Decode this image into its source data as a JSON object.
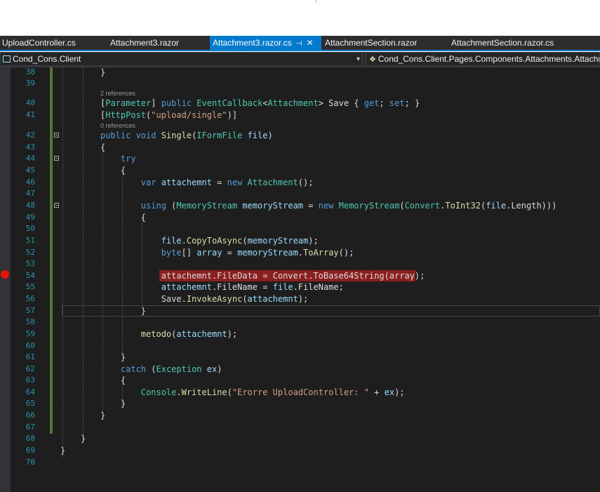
{
  "tabs": [
    {
      "label": "UploadController.cs",
      "active": false
    },
    {
      "label": "Attachment3.razor",
      "active": false
    },
    {
      "label": "Attachment3.razor.cs",
      "active": true
    },
    {
      "label": "AttachmentSection.razor",
      "active": false
    },
    {
      "label": "AttachmentSection.razor.cs",
      "active": false
    }
  ],
  "tab_icons": {
    "pin": "pin-icon",
    "close": "close-icon"
  },
  "navbar": {
    "project": "Cond_Cons.Client",
    "class_path": "Cond_Cons.Client.Pages.Components.Attachments.Attachm"
  },
  "codelens": {
    "line40": "2 references",
    "line42": "0 references"
  },
  "lines": [
    {
      "num": "38",
      "tokens": [
        [
          "pr",
          "}"
        ]
      ]
    },
    {
      "num": "39",
      "tokens": []
    },
    {
      "num": "40",
      "tokens": [
        [
          "pr",
          "["
        ],
        [
          "ty",
          "Parameter"
        ],
        [
          "pr",
          "] "
        ],
        [
          "kw",
          "public "
        ],
        [
          "ty",
          "EventCallback"
        ],
        [
          "pr",
          "<"
        ],
        [
          "ty",
          "Attachment"
        ],
        [
          "pr",
          "> Save { "
        ],
        [
          "kw",
          "get"
        ],
        [
          "pr",
          "; "
        ],
        [
          "kw",
          "set"
        ],
        [
          "pr",
          "; }"
        ]
      ]
    },
    {
      "num": "41",
      "tokens": [
        [
          "pr",
          "["
        ],
        [
          "ty",
          "HttpPost"
        ],
        [
          "pr",
          "("
        ],
        [
          "st",
          "\"upload/single\""
        ],
        [
          "pr",
          ")]"
        ]
      ]
    },
    {
      "num": "42",
      "tokens": [
        [
          "kw",
          "public void "
        ],
        [
          "fn",
          "Single"
        ],
        [
          "pr",
          "("
        ],
        [
          "ty",
          "IFormFile"
        ],
        [
          "pr",
          " "
        ],
        [
          "vr",
          "file"
        ],
        [
          "pr",
          ")"
        ]
      ]
    },
    {
      "num": "43",
      "tokens": [
        [
          "pr",
          "{"
        ]
      ]
    },
    {
      "num": "44",
      "tokens": [
        [
          "pr",
          "    "
        ],
        [
          "kw",
          "try"
        ]
      ]
    },
    {
      "num": "45",
      "tokens": [
        [
          "pr",
          "    {"
        ]
      ]
    },
    {
      "num": "46",
      "tokens": [
        [
          "pr",
          "        "
        ],
        [
          "kw",
          "var "
        ],
        [
          "vr",
          "attachemnt"
        ],
        [
          "pr",
          " = "
        ],
        [
          "kw",
          "new "
        ],
        [
          "ty",
          "Attachment"
        ],
        [
          "pr",
          "();"
        ]
      ]
    },
    {
      "num": "47",
      "tokens": []
    },
    {
      "num": "48",
      "tokens": [
        [
          "pr",
          "        "
        ],
        [
          "kw",
          "using "
        ],
        [
          "pr",
          "("
        ],
        [
          "ty",
          "MemoryStream"
        ],
        [
          "pr",
          " "
        ],
        [
          "vr",
          "memoryStream"
        ],
        [
          "pr",
          " = "
        ],
        [
          "kw",
          "new "
        ],
        [
          "ty",
          "MemoryStream"
        ],
        [
          "pr",
          "("
        ],
        [
          "ty",
          "Convert"
        ],
        [
          "pr",
          "."
        ],
        [
          "fn",
          "ToInt32"
        ],
        [
          "pr",
          "("
        ],
        [
          "vr",
          "file"
        ],
        [
          "pr",
          ".Length)))"
        ]
      ]
    },
    {
      "num": "49",
      "tokens": [
        [
          "pr",
          "        {"
        ]
      ]
    },
    {
      "num": "50",
      "tokens": []
    },
    {
      "num": "51",
      "tokens": [
        [
          "pr",
          "            "
        ],
        [
          "vr",
          "file"
        ],
        [
          "pr",
          "."
        ],
        [
          "fn",
          "CopyToAsync"
        ],
        [
          "pr",
          "("
        ],
        [
          "vr",
          "memoryStream"
        ],
        [
          "pr",
          ");"
        ]
      ]
    },
    {
      "num": "52",
      "tokens": [
        [
          "pr",
          "            "
        ],
        [
          "kw",
          "byte"
        ],
        [
          "pr",
          "[] "
        ],
        [
          "vr",
          "array"
        ],
        [
          "pr",
          " = "
        ],
        [
          "vr",
          "memoryStream"
        ],
        [
          "pr",
          "."
        ],
        [
          "fn",
          "ToArray"
        ],
        [
          "pr",
          "();"
        ]
      ]
    },
    {
      "num": "53",
      "tokens": []
    },
    {
      "num": "54",
      "tokens": [
        [
          "pr",
          "            attachemnt.FileData = Convert.ToBase64String(array);"
        ]
      ]
    },
    {
      "num": "55",
      "tokens": [
        [
          "pr",
          "            "
        ],
        [
          "vr",
          "attachemnt"
        ],
        [
          "pr",
          ".FileName = "
        ],
        [
          "vr",
          "file"
        ],
        [
          "pr",
          ".FileName;"
        ]
      ]
    },
    {
      "num": "56",
      "tokens": [
        [
          "pr",
          "            Save."
        ],
        [
          "fn",
          "InvokeAsync"
        ],
        [
          "pr",
          "("
        ],
        [
          "vr",
          "attachemnt"
        ],
        [
          "pr",
          ");"
        ]
      ]
    },
    {
      "num": "57",
      "tokens": [
        [
          "pr",
          "        }"
        ]
      ]
    },
    {
      "num": "58",
      "tokens": []
    },
    {
      "num": "59",
      "tokens": [
        [
          "pr",
          "        "
        ],
        [
          "fn",
          "metodo"
        ],
        [
          "pr",
          "("
        ],
        [
          "vr",
          "attachemnt"
        ],
        [
          "pr",
          ");"
        ]
      ]
    },
    {
      "num": "60",
      "tokens": []
    },
    {
      "num": "61",
      "tokens": [
        [
          "pr",
          "    }"
        ]
      ]
    },
    {
      "num": "62",
      "tokens": [
        [
          "pr",
          "    "
        ],
        [
          "kw",
          "catch "
        ],
        [
          "pr",
          "("
        ],
        [
          "ty",
          "Exception"
        ],
        [
          "pr",
          " "
        ],
        [
          "vr",
          "ex"
        ],
        [
          "pr",
          ")"
        ]
      ]
    },
    {
      "num": "63",
      "tokens": [
        [
          "pr",
          "    {"
        ]
      ]
    },
    {
      "num": "64",
      "tokens": [
        [
          "pr",
          "        "
        ],
        [
          "ty",
          "Console"
        ],
        [
          "pr",
          "."
        ],
        [
          "fn",
          "WriteLine"
        ],
        [
          "pr",
          "("
        ],
        [
          "st",
          "\"Erorre UploadController: \""
        ],
        [
          "pr",
          " + "
        ],
        [
          "vr",
          "ex"
        ],
        [
          "pr",
          ");"
        ]
      ]
    },
    {
      "num": "65",
      "tokens": [
        [
          "pr",
          "    }"
        ]
      ]
    },
    {
      "num": "66",
      "tokens": [
        [
          "pr",
          "}"
        ]
      ]
    },
    {
      "num": "67",
      "tokens": []
    },
    {
      "num": "68",
      "tokens": [
        [
          "pr",
          "}"
        ]
      ]
    },
    {
      "num": "69",
      "tokens": [
        [
          "pr",
          "}"
        ]
      ]
    },
    {
      "num": "70",
      "tokens": []
    }
  ],
  "breakpoint_line": "54",
  "colors": {
    "keyword": "#569cd6",
    "type": "#4ec9b0",
    "method": "#dcdcaa",
    "string": "#d69d85",
    "variable": "#9cdcfe",
    "breakpoint": "#e51400",
    "accent": "#007acc"
  }
}
